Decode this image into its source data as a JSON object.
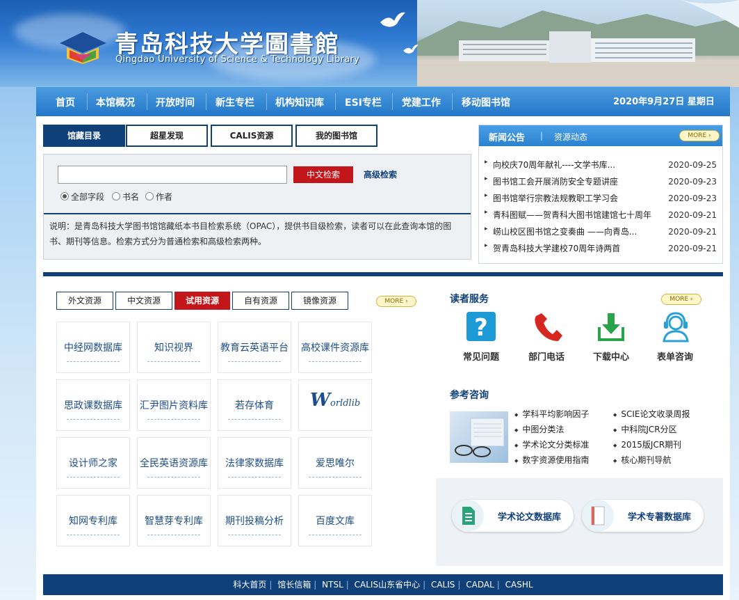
{
  "header": {
    "title_cn": "青岛科技大学圖書館",
    "title_en": "Qingdao University of Science & Technology Library"
  },
  "nav": {
    "items": [
      "首页",
      "本馆概况",
      "开放时间",
      "新生专栏",
      "机构知识库",
      "ESI专栏",
      "党建工作",
      "移动图书馆"
    ],
    "date": "2020年9月27日 星期日"
  },
  "search": {
    "tabs": [
      "馆藏目录",
      "超星发现",
      "CALIS资源",
      "我的图书馆"
    ],
    "active_tab": "馆藏目录",
    "input_value": "",
    "button": "中文检索",
    "advanced": "高级检索",
    "radios": [
      "全部字段",
      "书名",
      "作者"
    ],
    "selected_radio": "全部字段",
    "description": "说明：是青岛科技大学图书馆馆藏纸本书目检索系统（OPAC），提供书目级检索，读者可以在此查询本馆的图书、期刊等信息。检索方式分为普通检索和高级检索两种。"
  },
  "news": {
    "tab1": "新闻公告",
    "tab2": "资源动态",
    "more": "MORE",
    "items": [
      {
        "title": "向校庆70周年献礼----文学书库...",
        "date": "2020-09-25"
      },
      {
        "title": "图书馆工会开展消防安全专题讲座",
        "date": "2020-09-23"
      },
      {
        "title": "图书馆举行宗教法规教职工学习会",
        "date": "2020-09-23"
      },
      {
        "title": "青科图赋——贺青科大图书馆建馆七十周年",
        "date": "2020-09-21"
      },
      {
        "title": "崂山校区图书馆之变奏曲 ——向青岛...",
        "date": "2020-09-21"
      },
      {
        "title": "贺青岛科技大学建校70周年诗两首",
        "date": "2020-09-21"
      }
    ]
  },
  "resources": {
    "tabs": [
      "外文资源",
      "中文资源",
      "试用资源",
      "自有资源",
      "镜像资源"
    ],
    "active_tab": "试用资源",
    "more": "MORE",
    "cells": [
      "中经网数据库",
      "知识视界",
      "教育云英语平台",
      "高校课件资源库",
      "思政课数据库",
      "汇尹图片资料库",
      "若存体育",
      "Worldlib",
      "设计师之家",
      "全民英语资源库",
      "法律家数据库",
      "爱思唯尔",
      "知网专利库",
      "智慧芽专利库",
      "期刊投稿分析",
      "百度文库"
    ],
    "worldlib_initial": "W",
    "worldlib_rest": "orldlib"
  },
  "services": {
    "title": "读者服务",
    "more": "MORE",
    "items": [
      {
        "label": "常见问题",
        "icon": "question-icon",
        "color": "#1b9ad6"
      },
      {
        "label": "部门电话",
        "icon": "phone-icon",
        "color": "#d5261f"
      },
      {
        "label": "下载中心",
        "icon": "download-icon",
        "color": "#2aa34a"
      },
      {
        "label": "表单咨询",
        "icon": "headset-icon",
        "color": "#2aa0d8"
      }
    ]
  },
  "reference": {
    "title": "参考咨询",
    "left": [
      "学科平均影响因子",
      "中图分类法",
      "学术论文分类标准",
      "数字资源使用指南"
    ],
    "right": [
      "SCIE论文收录周报",
      "中科院JCR分区",
      "2015版JCR期刊",
      "核心期刊导航"
    ]
  },
  "databases": [
    "学术论文数据库",
    "学术专著数据库"
  ],
  "footer": [
    "科大首页",
    "馆长信箱",
    "NTSL",
    "CALIS山东省中心",
    "CALIS",
    "CADAL",
    "CASHL"
  ]
}
